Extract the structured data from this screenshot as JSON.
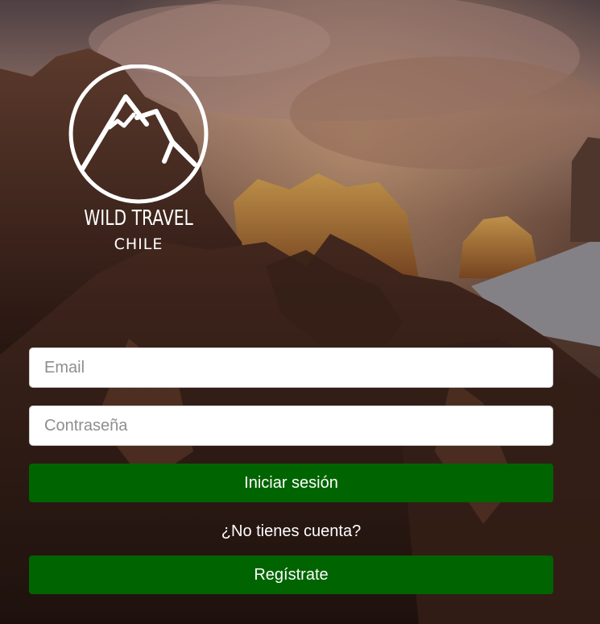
{
  "brand": {
    "title": "WILD TRAVEL",
    "subtitle": "CHILE"
  },
  "form": {
    "email_placeholder": "Email",
    "password_placeholder": "Contraseña",
    "login_label": "Iniciar sesión",
    "no_account_text": "¿No tienes cuenta?",
    "register_label": "Regístrate"
  },
  "colors": {
    "button": "#006400",
    "text_light": "#ffffff"
  },
  "icons": {
    "logo": "mountain-circle-logo"
  }
}
